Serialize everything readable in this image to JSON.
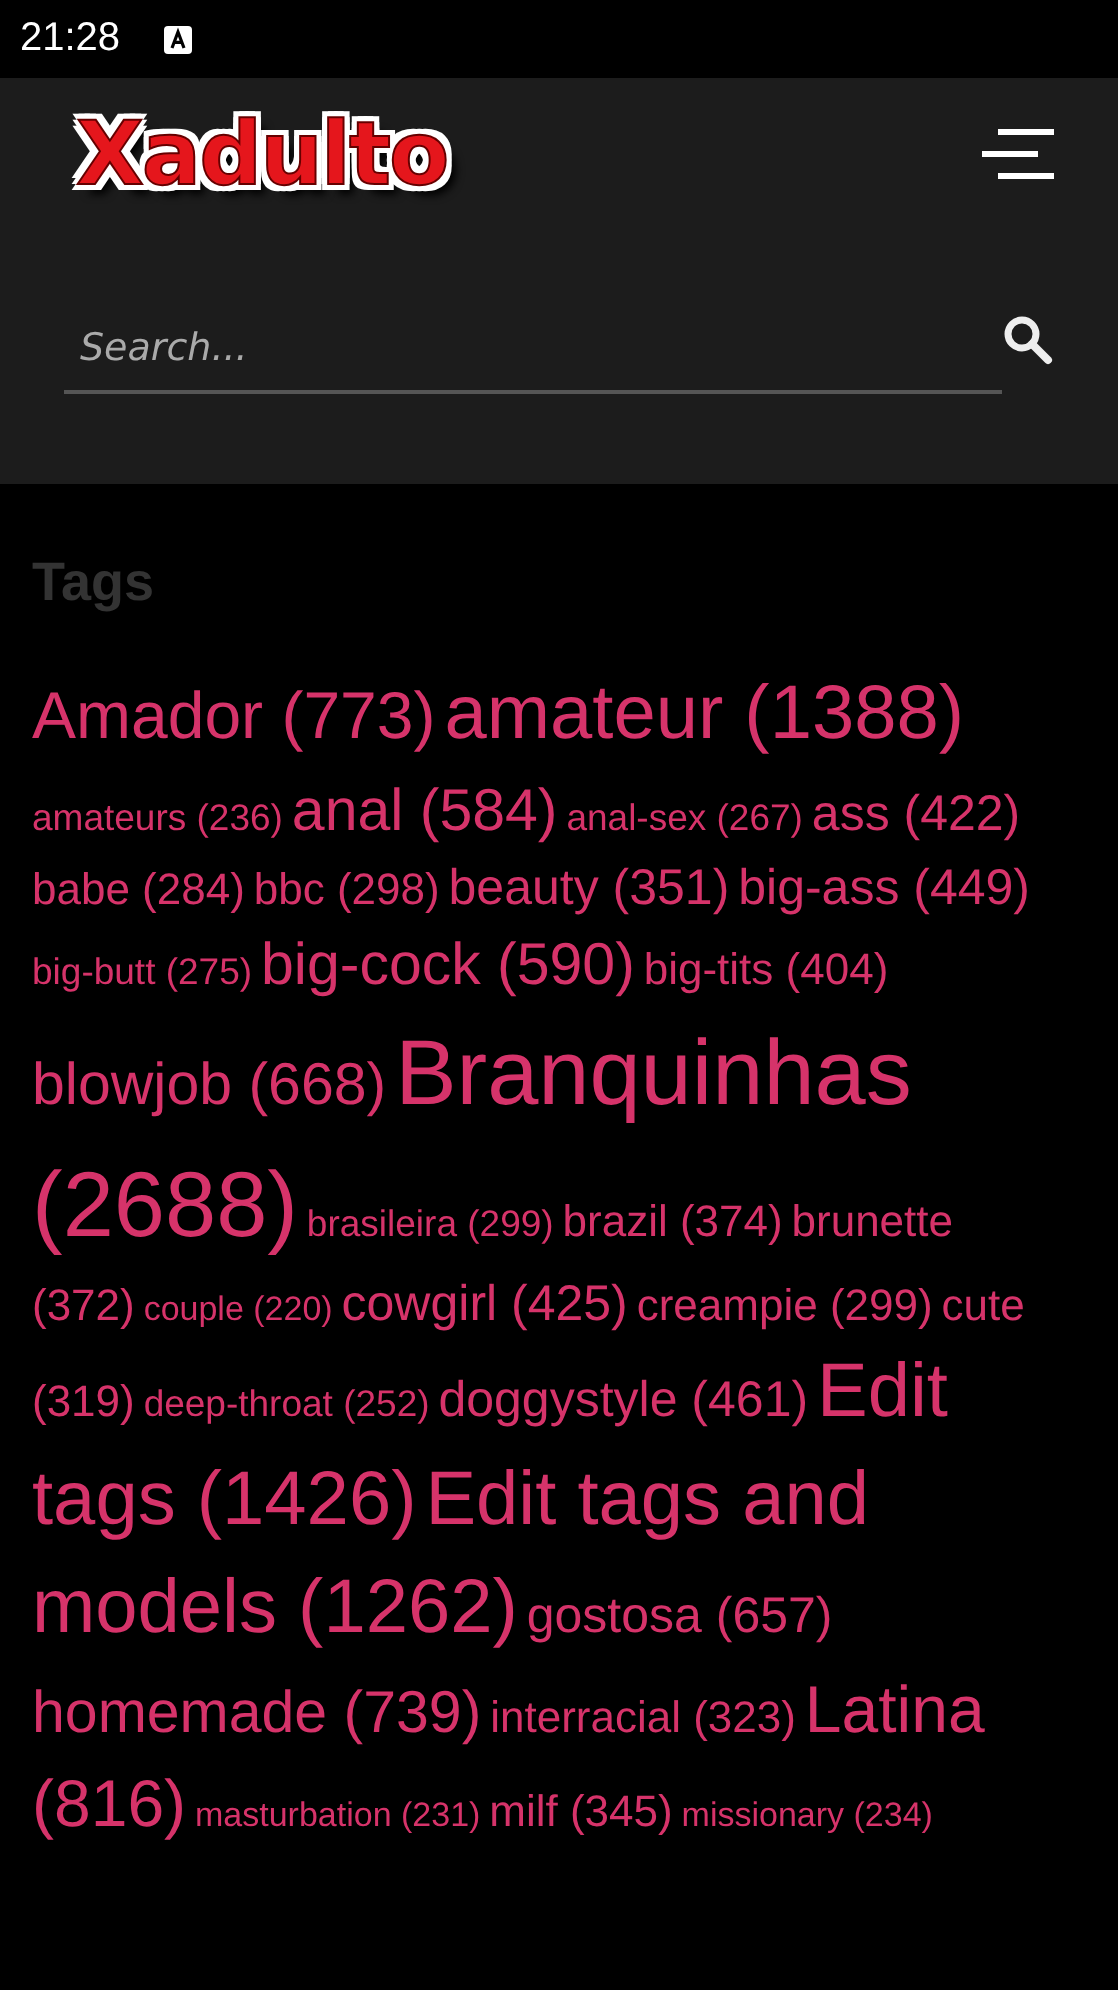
{
  "status_bar": {
    "time": "21:28"
  },
  "header": {
    "logo": "Xadulto",
    "search": {
      "placeholder": "Search..."
    }
  },
  "tags_section": {
    "title": "Tags",
    "lines": [
      [
        {
          "label": "Amador (773)",
          "kind": "xxl"
        },
        {
          "label": "amateur (1388)",
          "kind": "xxxl"
        }
      ],
      [
        {
          "label": "amateurs (236)",
          "kind": "s"
        },
        {
          "label": "anal (584)",
          "kind": "xl"
        },
        {
          "label": "anal-sex (267)",
          "kind": "s"
        },
        {
          "label": "ass (422)",
          "kind": "l"
        }
      ],
      [
        {
          "label": "babe (284)",
          "kind": "m"
        },
        {
          "label": "bbc (298)",
          "kind": "m"
        },
        {
          "label": "beauty (351)",
          "kind": "l"
        },
        {
          "label": "big-ass (449)",
          "kind": "l"
        }
      ],
      [
        {
          "label": "big-butt (275)",
          "kind": "s"
        },
        {
          "label": "big-cock (590)",
          "kind": "xl"
        },
        {
          "label": "big-tits (404)",
          "kind": "m"
        }
      ],
      [
        {
          "label": "blowjob (668)",
          "kind": "xl"
        },
        {
          "label": "Branquinhas",
          "kind": "huge"
        }
      ],
      [
        {
          "label": "(2688)",
          "kind": "huge"
        },
        {
          "label": "brasileira (299)",
          "kind": "s"
        },
        {
          "label": "brazil (374)",
          "kind": "m"
        },
        {
          "label": "brunette",
          "kind": "m"
        }
      ],
      [
        {
          "label": "(372)",
          "kind": "m"
        },
        {
          "label": "couple (220)",
          "kind": "xs"
        },
        {
          "label": "cowgirl (425)",
          "kind": "l"
        },
        {
          "label": "creampie (299)",
          "kind": "m"
        },
        {
          "label": "cute",
          "kind": "m"
        }
      ],
      [
        {
          "label": "(319)",
          "kind": "m"
        },
        {
          "label": "deep-throat (252)",
          "kind": "s"
        },
        {
          "label": "doggystyle (461)",
          "kind": "l"
        },
        {
          "label": "Edit",
          "kind": "xxxl"
        }
      ],
      [
        {
          "label": "tags (1426)",
          "kind": "xxxl"
        },
        {
          "label": "Edit tags and",
          "kind": "xxxl"
        }
      ],
      [
        {
          "label": "models (1262)",
          "kind": "xxxl"
        },
        {
          "label": "gostosa (657)",
          "kind": "l"
        }
      ],
      [
        {
          "label": "homemade (739)",
          "kind": "xl"
        },
        {
          "label": "interracial (323)",
          "kind": "m"
        },
        {
          "label": "Latina",
          "kind": "xxl"
        }
      ],
      [
        {
          "label": "(816)",
          "kind": "xxl"
        },
        {
          "label": "masturbation (231)",
          "kind": "xs"
        },
        {
          "label": "milf (345)",
          "kind": "m"
        },
        {
          "label": "missionary (234)",
          "kind": "xs"
        }
      ]
    ]
  }
}
